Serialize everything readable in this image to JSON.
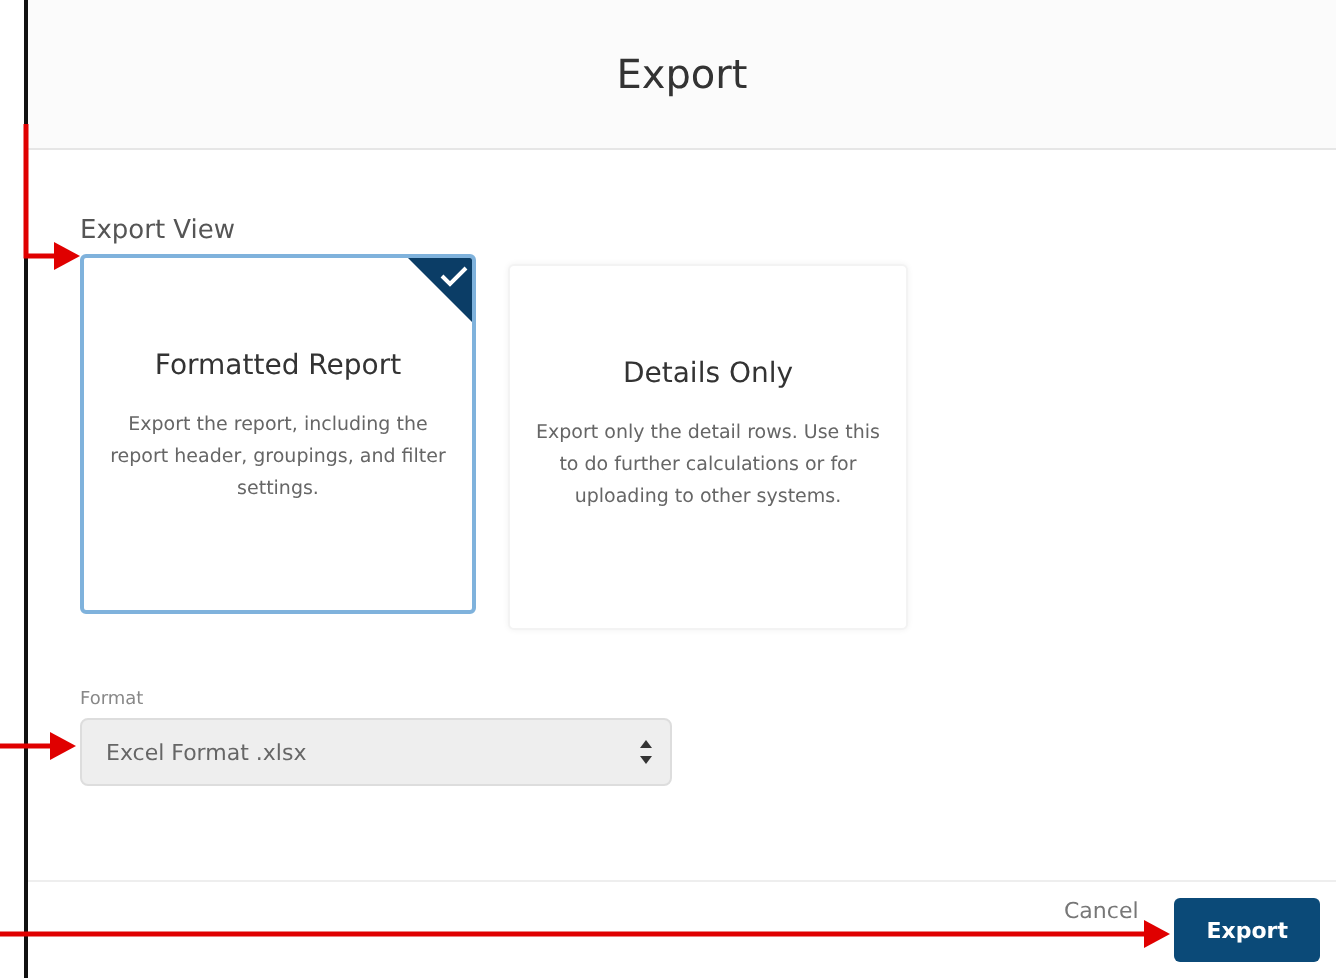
{
  "dialog": {
    "title": "Export"
  },
  "export_view": {
    "label": "Export View",
    "options": [
      {
        "title": "Formatted Report",
        "description": "Export the report, including the report header, groupings, and filter settings.",
        "selected": true
      },
      {
        "title": "Details Only",
        "description": "Export only the detail rows. Use this to do further calculations or for uploading to other systems.",
        "selected": false
      }
    ]
  },
  "format": {
    "label": "Format",
    "value": "Excel Format .xlsx"
  },
  "buttons": [
    {
      "label": "Cancel",
      "kind": "secondary"
    },
    {
      "label": "Export",
      "kind": "primary"
    }
  ]
}
